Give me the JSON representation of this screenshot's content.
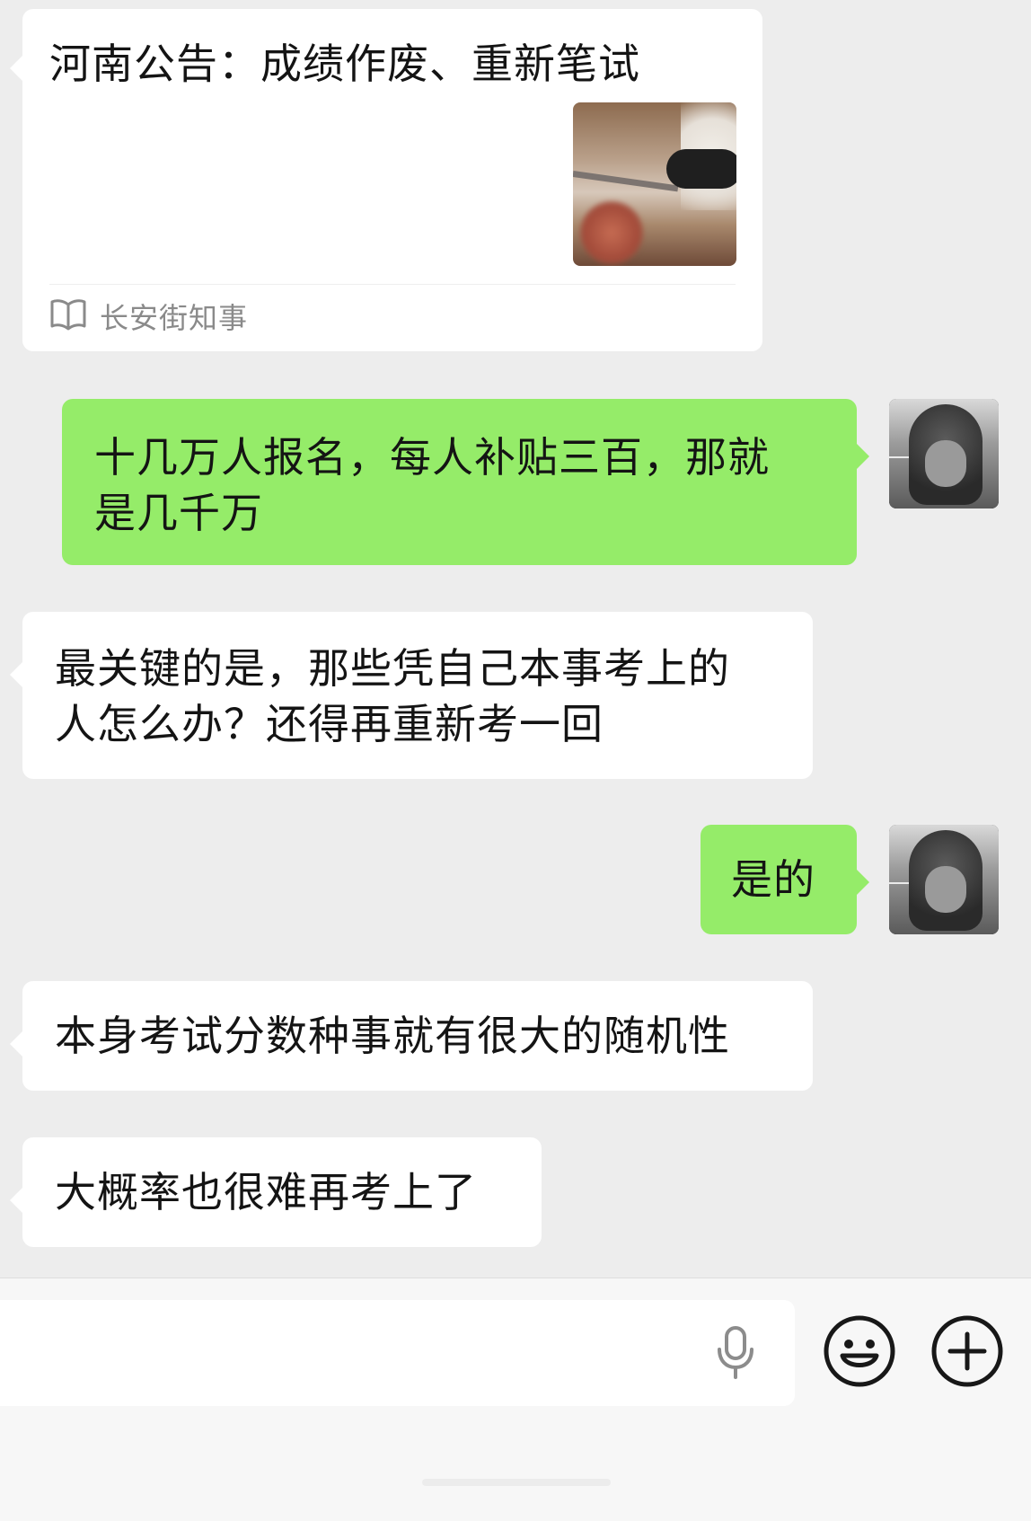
{
  "card": {
    "title": "河南公告：成绩作废、重新笔试",
    "source": "长安街知事"
  },
  "messages": [
    {
      "id": "m1",
      "side": "right",
      "text_lines": [
        "十几万人报名，每人补贴三百，那就",
        "是几千万"
      ]
    },
    {
      "id": "m2",
      "side": "left",
      "text_lines": [
        "最关键的是，那些凭自己本事考上的",
        "人怎么办？还得再重新考一回"
      ]
    },
    {
      "id": "m3",
      "side": "right",
      "text_lines": [
        "是的"
      ]
    },
    {
      "id": "m4",
      "side": "left",
      "text_lines": [
        "本身考试分数种事就有很大的随机性"
      ]
    },
    {
      "id": "m5",
      "side": "left",
      "text_lines": [
        "大概率也很难再考上了"
      ]
    }
  ],
  "input_bar": {
    "icons": [
      "microphone-icon",
      "emoji-icon",
      "plus-icon"
    ]
  }
}
